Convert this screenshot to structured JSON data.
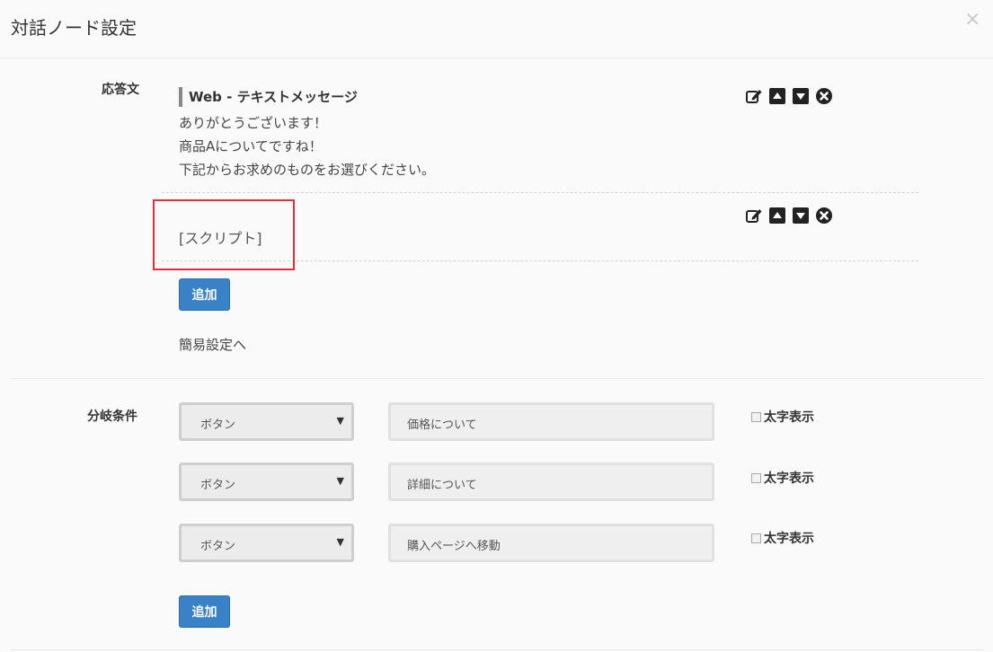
{
  "dialog": {
    "title": "対話ノード設定",
    "close_symbol": "×"
  },
  "response": {
    "label": "応答文",
    "items": [
      {
        "heading": "Web - テキストメッセージ",
        "lines": [
          "ありがとうございます！",
          "商品Aについてですね！",
          "下記からお求めのものをお選びください。"
        ],
        "actions": [
          "edit-icon",
          "move-up-icon",
          "move-down-icon",
          "delete-icon"
        ]
      },
      {
        "text": "[スクリプト]",
        "actions": [
          "edit-icon",
          "move-up-icon",
          "move-down-icon",
          "delete-icon"
        ]
      }
    ],
    "add_label": "追加",
    "simple_settings_link": "簡易設定へ"
  },
  "branch": {
    "label": "分岐条件",
    "rows": [
      {
        "type": "ボタン",
        "text": "価格について",
        "bold_label": "太字表示",
        "bold": false
      },
      {
        "type": "ボタン",
        "text": "詳細について",
        "bold_label": "太字表示",
        "bold": false
      },
      {
        "type": "ボタン",
        "text": "購入ページへ移動",
        "bold_label": "太字表示",
        "bold": false
      }
    ],
    "add_label": "追加"
  },
  "colors": {
    "primary_button": "#3a82c7",
    "highlight_box": "#e0303a"
  }
}
